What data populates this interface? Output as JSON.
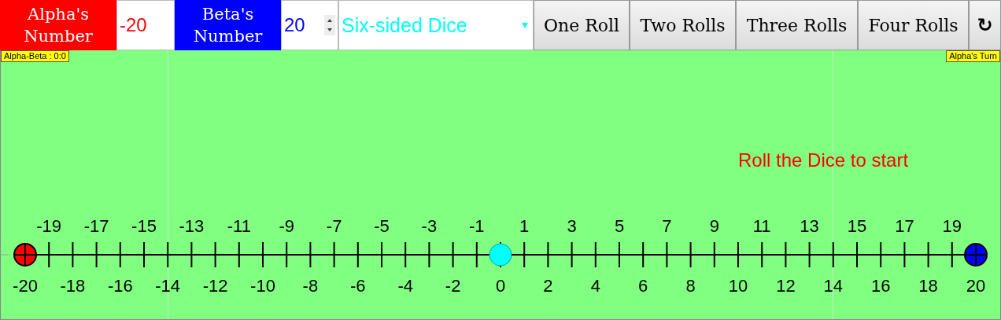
{
  "toolbar": {
    "alpha_label": "Alpha's Number",
    "alpha_value": "-20",
    "beta_label": "Beta's Number",
    "beta_value": "20",
    "dice_select": "Six-sided Dice",
    "buttons": [
      {
        "kind": "text",
        "label": "One Roll"
      },
      {
        "kind": "text",
        "label": "Two Rolls"
      },
      {
        "kind": "text",
        "label": "Three Rolls"
      },
      {
        "kind": "text",
        "label": "Four Rolls"
      },
      {
        "kind": "reset",
        "label": "↻"
      }
    ]
  },
  "board": {
    "score_badge": "Alpha-Beta : 0:0",
    "turn_badge": "Alpha's Turn",
    "message": "Roll the Dice to start",
    "number_line": {
      "top_labels": [
        "-19",
        "-17",
        "-15",
        "-13",
        "-11",
        "-9",
        "-7",
        "-5",
        "-3",
        "-1",
        "1",
        "3",
        "5",
        "7",
        "9",
        "11",
        "13",
        "15",
        "17",
        "19"
      ],
      "bottom_labels": [
        "-20",
        "-18",
        "-16",
        "-14",
        "-12",
        "-10",
        "-8",
        "-6",
        "-4",
        "-2",
        "0",
        "2",
        "4",
        "6",
        "8",
        "10",
        "12",
        "14",
        "16",
        "18",
        "20"
      ],
      "markers": [
        {
          "kind": "alpha",
          "color": "#ff0000"
        },
        {
          "kind": "origin",
          "color": "#00ffff"
        },
        {
          "kind": "beta",
          "color": "#0000ff"
        }
      ]
    }
  }
}
